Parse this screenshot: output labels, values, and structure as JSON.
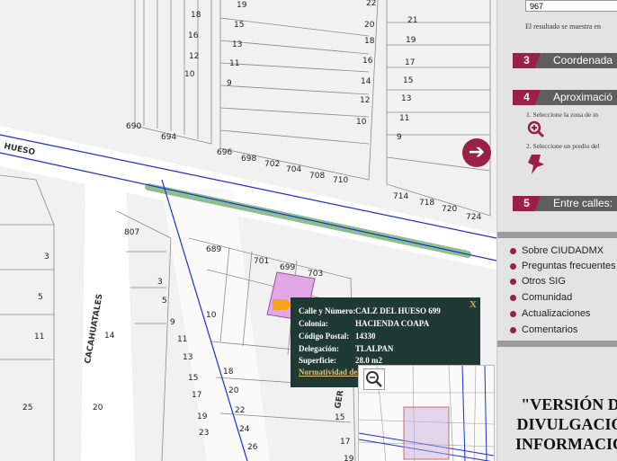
{
  "map": {
    "street_label": "HUESO",
    "side_street_label": "CACAHUATALES",
    "partial_street_label": "GER",
    "lot_numbers": [
      "18",
      "16",
      "12",
      "10",
      "19",
      "15",
      "13",
      "11",
      "9",
      "22",
      "20",
      "18",
      "16",
      "14",
      "12",
      "10",
      "21",
      "19",
      "17",
      "15",
      "13",
      "11",
      "9",
      "690",
      "694",
      "696",
      "698",
      "702",
      "704",
      "708",
      "710",
      "714",
      "718",
      "720",
      "724",
      "807",
      "689",
      "701",
      "699",
      "703",
      "3",
      "5",
      "11",
      "3",
      "5",
      "9",
      "11",
      "13",
      "15",
      "17",
      "19",
      "23",
      "14",
      "10",
      "18",
      "20",
      "22",
      "24",
      "26",
      "25",
      "20",
      "13",
      "15",
      "17",
      "19"
    ]
  },
  "popup": {
    "rows": [
      {
        "label": "Calle y Número:",
        "value": "CALZ DEL HUESO 699"
      },
      {
        "label": "Colonia:",
        "value": "HACIENDA COAPA"
      },
      {
        "label": "Código Postal:",
        "value": "14330"
      },
      {
        "label": "Delegación:",
        "value": "TLALPAN"
      },
      {
        "label": "Superficie:",
        "value": "28.0 m2"
      }
    ],
    "link_label": "Normatividad del",
    "close_label": "X"
  },
  "nav_button_icon": "arrow-right-icon",
  "panel": {
    "result_value": "967",
    "result_note": "El resultado se muestra en",
    "steps": [
      {
        "num": "3",
        "label": "Coordenada"
      },
      {
        "num": "4",
        "label": "Aproximació"
      },
      {
        "num": "5",
        "label": "Entre calles:"
      }
    ],
    "sub_items": [
      "1. Seleccione la zona de in",
      "2. Seleccione un predio del"
    ],
    "icons": [
      "zoom-in-icon",
      "pin-icon"
    ],
    "menu": [
      "Sobre CIUDADMX",
      "Preguntas frecuentes",
      "Otros SIG",
      "Comunidad",
      "Actualizaciones",
      "Comentarios"
    ],
    "banner": [
      "\"VERSIÓN D",
      "DIVULGACIÓ",
      "INFORMACIO"
    ]
  },
  "colors": {
    "accent": "#9b2046",
    "popup_bg": "#1f3a33",
    "highlight_lot": "#e2a8e6",
    "road_line": "#1a2fd6",
    "green_strip": "#8dbf8a"
  }
}
